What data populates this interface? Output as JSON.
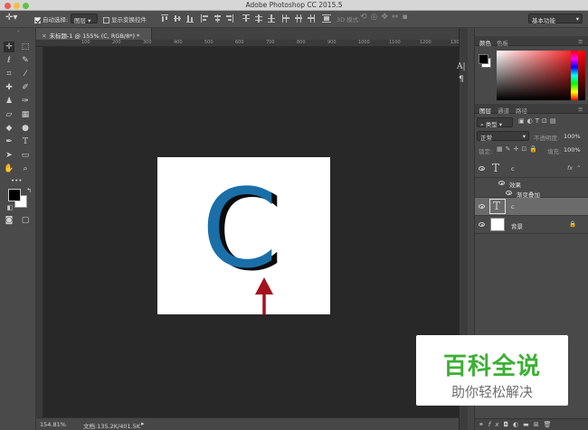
{
  "window": {
    "title": "Adobe Photoshop CC 2015.5"
  },
  "options_bar": {
    "auto_select_label": "自动选择:",
    "auto_select_value": "图层",
    "show_transform_label": "显示变换控件",
    "mode_3d_label": "3D 模式:",
    "workspace_value": "基本功能"
  },
  "document": {
    "tab_title": "未标题-1 @ 155% (C, RGB/8*) *",
    "ruler_ticks": [
      "100",
      "200",
      "300",
      "400",
      "500",
      "600",
      "700",
      "800",
      "900",
      "1000",
      "1100",
      "1200",
      "1300"
    ],
    "canvas_letter": "C"
  },
  "status_bar": {
    "zoom": "154.81%",
    "doc_info": "文档:135.2K/401.5K"
  },
  "color_panel": {
    "tabs": [
      "颜色",
      "色板"
    ],
    "foreground": "#000000",
    "background": "#ffffff"
  },
  "layers_panel": {
    "tabs": [
      "图层",
      "通道",
      "路径"
    ],
    "filter_label": "类型",
    "blend_mode": "正常",
    "opacity_label": "不透明度:",
    "opacity_value": "100%",
    "lock_label": "锁定:",
    "fill_label": "填充:",
    "fill_value": "100%",
    "layers": [
      {
        "name": "c",
        "type": "text",
        "has_fx": true,
        "fx_label": "fx"
      },
      {
        "name": "效果",
        "type": "effects-header"
      },
      {
        "name": "渐变叠加",
        "type": "effect"
      },
      {
        "name": "c",
        "type": "text",
        "selected": true
      },
      {
        "name": "背景",
        "type": "background"
      }
    ]
  },
  "watermark": {
    "title": "百科全说",
    "subtitle": "助你轻松解决"
  },
  "colors": {
    "letter_blue": "#1a6fa8",
    "letter_shadow": "#0b0b0b",
    "arrow_red": "#a4121e",
    "watermark_green": "#3cb034"
  }
}
